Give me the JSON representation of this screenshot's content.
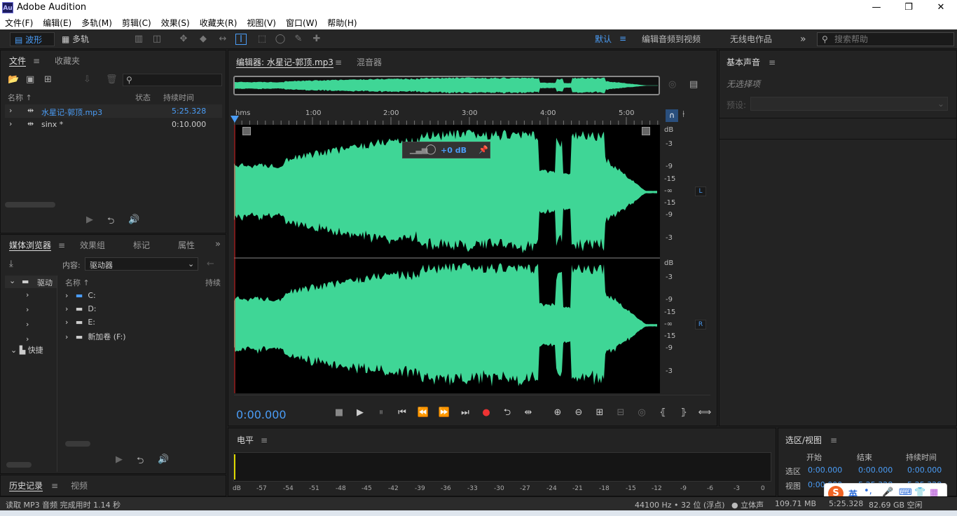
{
  "titlebar": {
    "app_icon": "Au",
    "title": "Adobe Audition",
    "minimize": "—",
    "maximize": "❐",
    "close": "✕"
  },
  "menu": [
    "文件(F)",
    "编辑(E)",
    "多轨(M)",
    "剪辑(C)",
    "效果(S)",
    "收藏夹(R)",
    "视图(V)",
    "窗口(W)",
    "帮助(H)"
  ],
  "toolbar": {
    "waveform": "波形",
    "multitrack": "多轨",
    "workspaces": [
      "默认",
      "编辑音频到视频",
      "无线电作品"
    ],
    "more": "»",
    "search_placeholder": "搜索帮助"
  },
  "files_panel": {
    "tabs": [
      "文件",
      "收藏夹"
    ],
    "columns": [
      "名称",
      "状态",
      "持续时间"
    ],
    "files": [
      {
        "name": "水星记-郭顶.mp3",
        "duration": "5:25.328",
        "selected": true
      },
      {
        "name": "sinx *",
        "duration": "0:10.000",
        "selected": false
      }
    ]
  },
  "media_panel": {
    "tabs": [
      "媒体浏览器",
      "效果组",
      "标记",
      "属性"
    ],
    "more": "»",
    "content_label": "内容:",
    "content_value": "驱动器",
    "tree": [
      "驱动",
      "快捷"
    ],
    "columns": [
      "名称",
      "持续"
    ],
    "drives": [
      "C:",
      "D:",
      "E:",
      "新加卷 (F:)"
    ]
  },
  "history_panel": {
    "tabs": [
      "历史记录",
      "视频"
    ]
  },
  "editor": {
    "tabs": [
      "编辑器: 水星记-郭顶.mp3",
      "混音器"
    ],
    "ruler_labels": [
      "hms",
      "1:00",
      "2:00",
      "3:00",
      "4:00",
      "5:00"
    ],
    "db_scale_left": [
      "dB",
      "-3",
      "-9",
      "-15",
      "-∞",
      "-15",
      "-9",
      "-3"
    ],
    "db_scale_right": [
      "dB",
      "-3",
      "-9",
      "-15",
      "-∞",
      "-15",
      "-9",
      "-3"
    ],
    "channel_L": "L",
    "channel_R": "R",
    "hud_gain": "+0 dB",
    "time": "0:00.000",
    "wave_color": "#3fd696"
  },
  "levels": {
    "title": "电平",
    "scale": [
      "dB",
      "-57",
      "-54",
      "-51",
      "-48",
      "-45",
      "-42",
      "-39",
      "-36",
      "-33",
      "-30",
      "-27",
      "-24",
      "-21",
      "-18",
      "-15",
      "-12",
      "-9",
      "-6",
      "-3",
      "0"
    ]
  },
  "basic_sound": {
    "title": "基本声音",
    "no_selection": "无选择项",
    "preset": "预设:"
  },
  "selection": {
    "title": "选区/视图",
    "columns": [
      "开始",
      "结束",
      "持续时间"
    ],
    "rows": [
      {
        "label": "选区",
        "start": "0:00.000",
        "end": "0:00.000",
        "duration": "0:00.000"
      },
      {
        "label": "视图",
        "start": "0:00.000",
        "end": "5:25.328",
        "duration": "5:25.328"
      }
    ]
  },
  "status": {
    "left": "读取 MP3 音频 完成用时 1.14 秒",
    "sample": "44100 Hz • 32 位 (浮点)",
    "channel": "● 立体声",
    "size": "109.71 MB",
    "duration": "5:25.328",
    "disk": "82.69 GB 空闲"
  },
  "ime": {
    "mode": "英"
  }
}
